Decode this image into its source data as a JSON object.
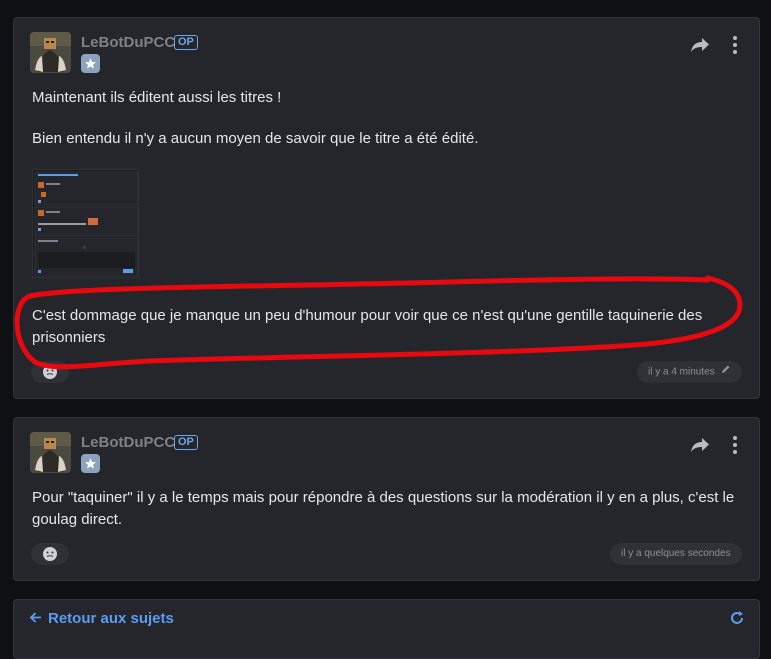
{
  "posts": [
    {
      "author": "LeBotDuPCC",
      "badge": "OP",
      "paragraphs": [
        "Maintenant ils éditent aussi les titres !",
        "Bien entendu il n'y a aucun moyen de savoir que le titre a été édité.",
        "C'est dommage que je manque un peu d'humour pour voir que ce n'est qu'une gentille taquinerie des prisonniers"
      ],
      "timestamp": "il y a 4 minutes",
      "edited": true
    },
    {
      "author": "LeBotDuPCC",
      "badge": "OP",
      "paragraphs": [
        "Pour \"taquiner\" il y a le temps mais pour répondre à des questions sur la modération il y en a plus, c'est le goulag direct."
      ],
      "timestamp": "il y a quelques secondes",
      "edited": false
    }
  ],
  "footer": {
    "back_label": "Retour aux sujets"
  },
  "colors": {
    "background": "#0f1013",
    "card": "#24262b",
    "accent": "#5b9cf0",
    "annotation": "#e8080f"
  }
}
